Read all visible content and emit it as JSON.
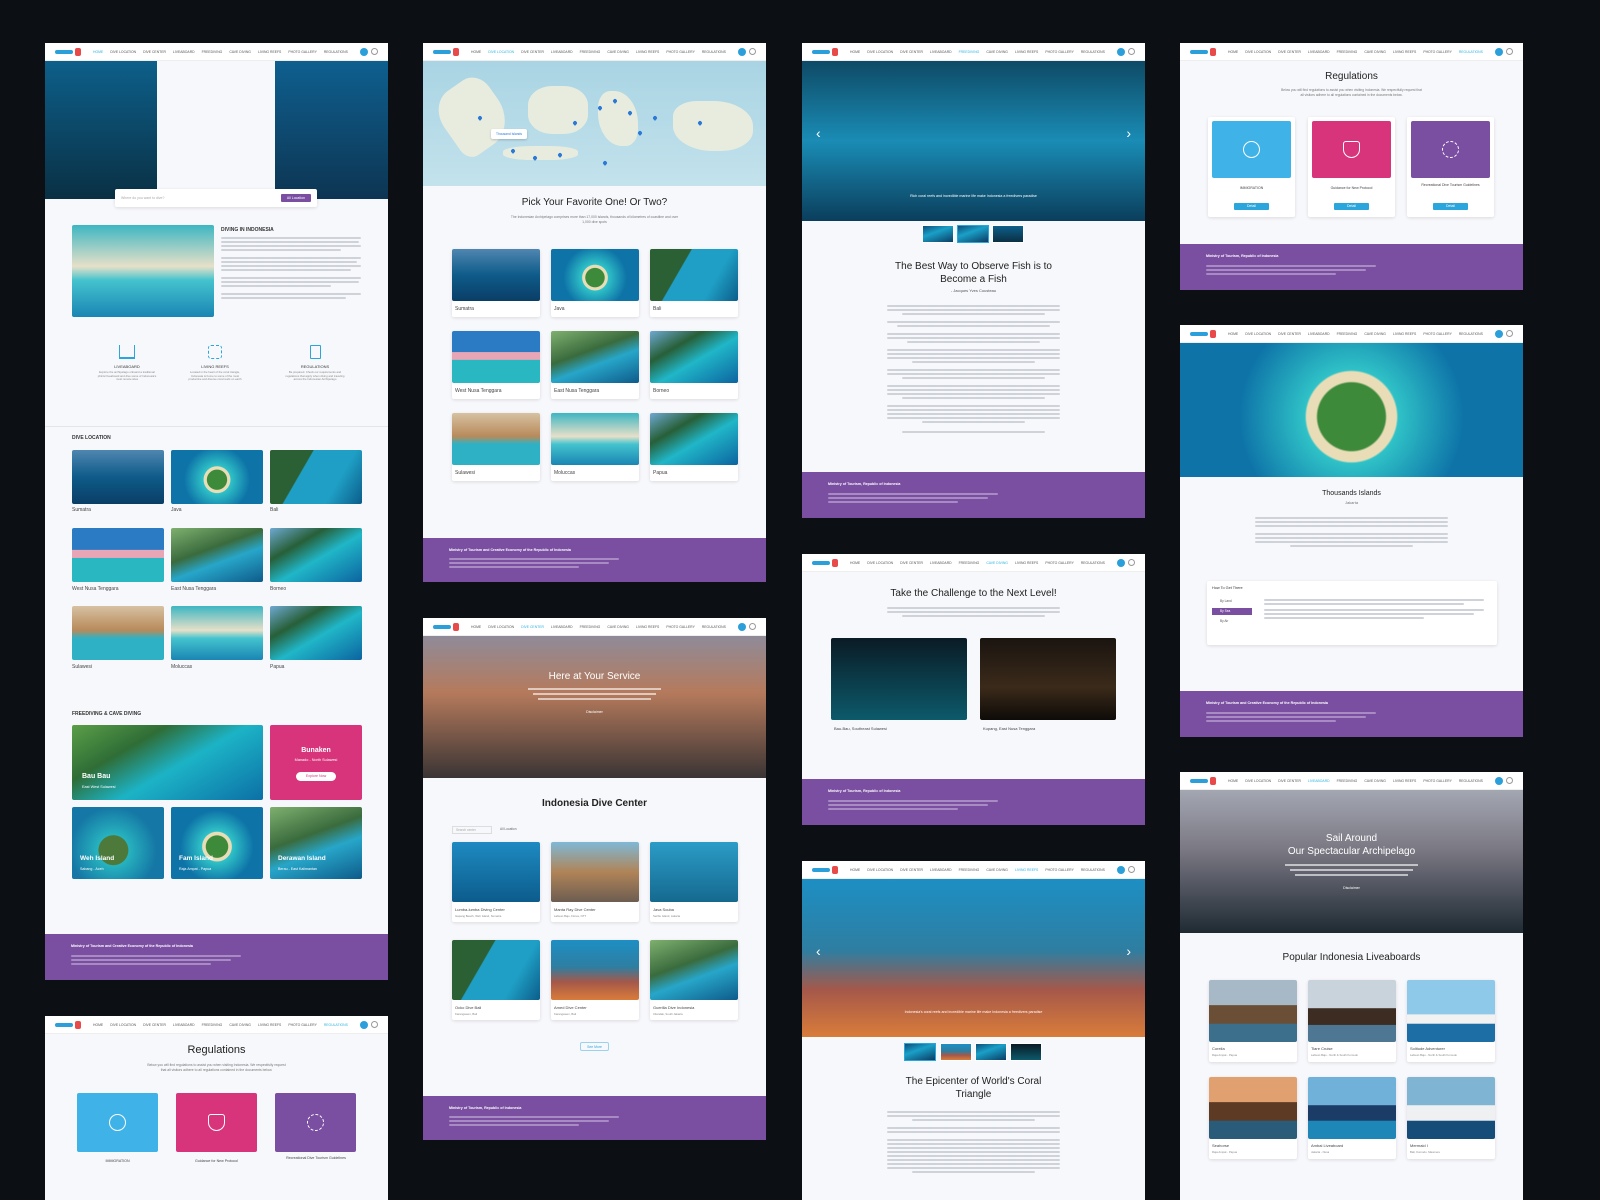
{
  "nav": {
    "items": [
      "Home",
      "Dive Location",
      "Dive Center",
      "Liveaboard",
      "Freediving",
      "Cave Diving",
      "Living Reefs",
      "Ayoberdiri Diarabesk",
      "Photo Gallery",
      "Regulations"
    ]
  },
  "home": {
    "search_placeholder": "Where do you want to dive?",
    "search_location": "All Location",
    "intro_title": "DIVING IN INDONESIA",
    "features": [
      {
        "icon": "boat-icon",
        "title": "LIVEABOARD",
        "text": "Explore the archipelago onboard a traditional phinisi liveaboard and dive some of Indonesia's most remote sites"
      },
      {
        "icon": "coral-icon",
        "title": "LIVING REEFS",
        "text": "Located in the heart of the coral triangle, Indonesia is home to some of the most productive and diverse coral reefs on earth"
      },
      {
        "icon": "clipboard-icon",
        "title": "REGULATIONS",
        "text": "Be prepared. Check our requirements and regulations that apply when diving and traveling across the Indonesian Archipelago"
      }
    ],
    "dive_location_title": "DIVE LOCATION",
    "locations": [
      "Sumatra",
      "Java",
      "Bali",
      "West Nusa Tenggara",
      "East Nusa Tenggara",
      "Borneo",
      "Sulawesi",
      "Moluccas",
      "Papua"
    ],
    "freediving_title": "FREEDIVING & CAVE DIVING",
    "spots": [
      {
        "name": "Bau Bau",
        "sub": "East West Sulawesi"
      },
      {
        "name": "Bunaken",
        "sub": "Manado - North Sulawesi",
        "cta": "Explore Now"
      },
      {
        "name": "Weh Island",
        "sub": "Sabang - Aceh"
      },
      {
        "name": "Fam Island",
        "sub": "Raja Ampat - Papua"
      },
      {
        "name": "Derawan Island",
        "sub": "Berau - East Kalimantan"
      }
    ]
  },
  "footer": {
    "org": "Ministry of Tourism and Creative Economy of the Republic of Indonesia",
    "org_short": "Ministry of Tourism, Republic of Indonesia"
  },
  "map_page": {
    "map_label": "Thousand Islands",
    "title": "Pick Your Favorite One! Or Two?",
    "intro": "The Indonesian Archipelago comprises more than 17,000 islands, thousands of kilometres of coastline and over 1,000 dive spots",
    "regions": [
      "Sumatra",
      "Java",
      "Bali",
      "West Nusa Tenggara",
      "East Nusa Tenggara",
      "Borneo",
      "Sulawesi",
      "Moluccas",
      "Papua"
    ]
  },
  "dive_center": {
    "hero_title": "Here at Your Service",
    "hero_button": "Disclaimer",
    "title": "Indonesia Dive Center",
    "filter_placeholder": "Search center",
    "filter_location": "All Location",
    "centers": [
      {
        "name": "Lumba-lumba Diving Center",
        "loc": "Gapang Beach, Weh Island, Sumatra"
      },
      {
        "name": "Manta Ray Dive Center",
        "loc": "Labuan Bajo, Flores, NTT"
      },
      {
        "name": "Java Scuba",
        "loc": "Seribu Island, Jakarta"
      },
      {
        "name": "Ocko Dive Bali",
        "loc": "Karangasem, Bali"
      },
      {
        "name": "Amed Dive Center",
        "loc": "Karangasem, Bali"
      },
      {
        "name": "Guerilla Dive Indonesia",
        "loc": "Cilandak, South Jakarta"
      }
    ],
    "see_more": "See More"
  },
  "freediving": {
    "caption": "Rich coral reefs and incredible marine life make Indonesia a freedivers paradise",
    "title": "The Best Way to Observe Fish is to Become a Fish",
    "quote": "- Jacques Yves Cousteau"
  },
  "cave": {
    "title": "Take the Challenge to the Next Level!",
    "items": [
      "Bau-Bau, Southeast Sulawesi",
      "Kupang, East Nusa Tenggara"
    ]
  },
  "reefs": {
    "caption": "Indonesia's coral reefs and incredible marine life make Indonesia a freedivers paradise",
    "title": "The Epicenter of World's Coral Triangle"
  },
  "regulations": {
    "title": "Regulations",
    "intro": "Below you will find regulations to assist you when visiting Indonesia. We respectfully request that all visitors adhere to all regulations contained in the documents below.",
    "items": [
      {
        "label": "IMMIGRATION",
        "color": "#3fb3e8",
        "icon": "globe-icon"
      },
      {
        "label": "Guidance for New Protocol",
        "color": "#d8347b",
        "icon": "shield-icon"
      },
      {
        "label": "Recreational Dive Tourism Guidelines",
        "color": "#7a4ea1",
        "icon": "diver-icon"
      }
    ],
    "detail": "Detail"
  },
  "thousand": {
    "title": "Thousands Islands",
    "subtitle": "Jakarta",
    "how_title": "How To Get There",
    "options": [
      "By Land",
      "By Sea",
      "By Air"
    ]
  },
  "liveaboard": {
    "hero_title_1": "Sail Around",
    "hero_title_2": "Our Spectacular Archipelago",
    "hero_button": "Disclaimer",
    "title": "Popular Indonesia Liveaboards",
    "boats": [
      {
        "name": "Corelia",
        "loc": "Raja Ampat - Papua"
      },
      {
        "name": "Tiare Cruise",
        "loc": "Labuan Bajo - North & South Komodo"
      },
      {
        "name": "Solitude Adventurer",
        "loc": "Labuan Bajo - North & South Komodo"
      },
      {
        "name": "Seahorse",
        "loc": "Raja Ampat - Papua"
      },
      {
        "name": "Ambai Liveaboard",
        "loc": "Jakarta - Nusa"
      },
      {
        "name": "Mermaid I",
        "loc": "Bali, Komodo, Maumere"
      }
    ]
  }
}
